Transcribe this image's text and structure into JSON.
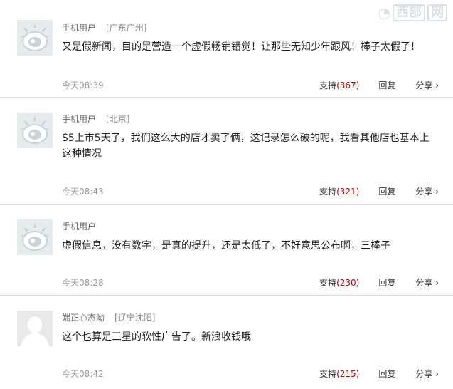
{
  "watermark": {
    "box_text": "西部",
    "glyph": "网"
  },
  "comments": [
    {
      "avatar": "weibo-default-avatar",
      "username": "手机用户",
      "location": "[广东广州]",
      "text": "又是假新闻，目的是营造一个虚假畅销错觉！让那些无知少年跟风！棒子太假了！",
      "time": "今天08:39",
      "support_label": "支持",
      "support_count": "(367)",
      "reply_label": "回复",
      "share_label": "分享 ›"
    },
    {
      "avatar": "weibo-default-avatar",
      "username": "手机用户",
      "location": "[北京]",
      "text": "S5上市5天了，我们这么大的店才卖了俩，这记录怎么破的呢，我看其他店也基本上这种情况",
      "time": "今天08:43",
      "support_label": "支持",
      "support_count": "(321)",
      "reply_label": "回复",
      "share_label": "分享 ›"
    },
    {
      "avatar": "weibo-default-avatar",
      "username": "手机用户",
      "location": "",
      "text": "虚假信息，没有数字，是真的提升，还是太低了，不好意思公布啊，三棒子",
      "time": "今天08:28",
      "support_label": "支持",
      "support_count": "(230)",
      "reply_label": "回复",
      "share_label": "分享 ›"
    },
    {
      "avatar": "person-silhouette-avatar",
      "username": "端正心态呦",
      "location": "[辽宁沈阳]",
      "text": "这个也算是三星的软性广告了。新浪收钱哦",
      "time": "今天08:42",
      "support_label": "支持",
      "support_count": "(215)",
      "reply_label": "回复",
      "share_label": "分享 ›"
    }
  ]
}
